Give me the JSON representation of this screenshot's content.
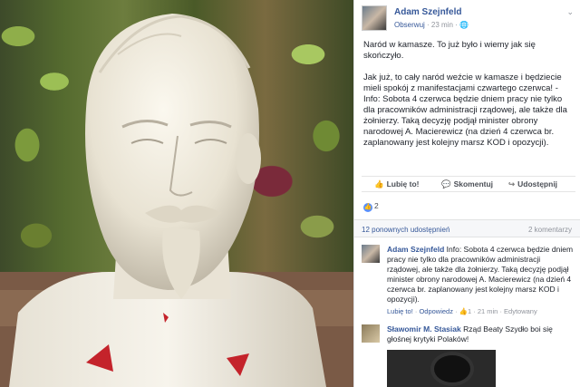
{
  "post": {
    "author": "Adam Szejnfeld",
    "follow": "Obserwuj",
    "time": " · 23 min · ",
    "paragraph1": "Naród w kamasze. To już było i wiemy jak się skończyło.",
    "paragraph2": "Jak już, to cały naród weźcie w kamasze i będziecie mieli spokój z manifestacjami czwartego czerwca! - Info: Sobota 4 czerwca będzie dniem pracy nie tylko dla pracowników administracji rządowej, ale także dla żołnierzy. Taką decyzję podjął minister obrony narodowej A. Macierewicz (na dzień 4 czerwca br. zaplanowany jest kolejny marsz KOD i opozycji)."
  },
  "actions": {
    "like": "Lubię to!",
    "comment": "Skomentuj",
    "share": "Udostępnij"
  },
  "likes_count": "2",
  "shares_label": "12 ponownych udostępnień",
  "comments_label": "2 komentarzy",
  "comments": [
    {
      "author": "Adam Szejnfeld",
      "text": " Info: Sobota 4 czerwca będzie dniem pracy nie tylko dla pracowników administracji rządowej, ale także dla żołnierzy. Taką decyzję podjął minister obrony narodowej A. Macierewicz (na dzień 4 czerwca br. zaplanowany jest kolejny marsz KOD i opozycji).",
      "like": "Lubię to!",
      "reply": "Odpowiedz",
      "likes": "1",
      "time": "21 min",
      "edited": "Edytowany"
    },
    {
      "author": "Sławomir M. Stasiak",
      "text": " Rząd Beaty Szydło boi się głośnej krytyki Polaków!"
    }
  ],
  "icons": {
    "like": "thumbs-up-icon",
    "comment": "speech-bubble-icon",
    "share": "share-arrow-icon"
  }
}
